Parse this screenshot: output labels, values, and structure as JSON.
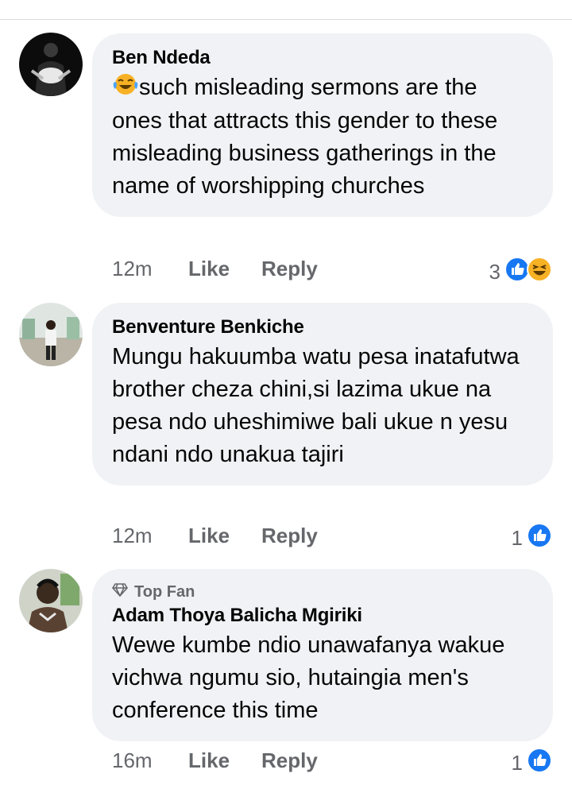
{
  "comments": [
    {
      "author": "Ben Ndeda",
      "text": "such misleading sermons are the ones that attracts this gender to these misleading business gatherings in the name of worshipping churches",
      "leading_emoji": "tears-of-joy-emoji",
      "time": "12m",
      "like_label": "Like",
      "reply_label": "Reply",
      "reaction_count": "3",
      "reactions": [
        "like",
        "haha"
      ]
    },
    {
      "author": "Benventure Benkiche",
      "text": "Mungu hakuumba watu pesa inatafutwa brother cheza chini,si lazima ukue na pesa ndo uheshimiwe bali ukue n yesu ndani ndo unakua tajiri",
      "time": "12m",
      "like_label": "Like",
      "reply_label": "Reply",
      "reaction_count": "1",
      "reactions": [
        "like"
      ]
    },
    {
      "badge": "Top Fan",
      "badge_icon": "diamond-icon",
      "author": "Adam Thoya Balicha Mgiriki",
      "text": "Wewe kumbe ndio unawafanya wakue vichwa ngumu sio, hutaingia men's conference this time",
      "time": "16m",
      "like_label": "Like",
      "reply_label": "Reply",
      "reaction_count": "1",
      "reactions": [
        "like"
      ]
    }
  ],
  "colors": {
    "like_blue": "#1877f2",
    "haha_yellow": "#f7b125",
    "bubble": "#f0f2f5",
    "meta_gray": "#65676b"
  }
}
